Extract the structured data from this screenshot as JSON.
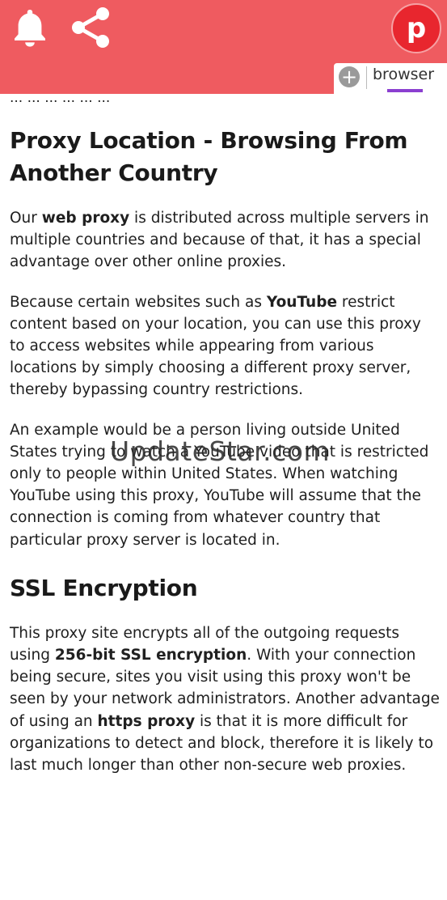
{
  "header": {
    "avatar_letter": "p",
    "tab_label": "browser",
    "add_tab_symbol": "+",
    "bg_color": "#ef5b60",
    "avatar_color": "#e8262e",
    "indicator_color": "#8b3fd0",
    "icons": [
      "bell-icon",
      "share-icon",
      "plus-icon"
    ]
  },
  "article": {
    "cut_off_text": "... ... ... ... ... ...",
    "h1": "Proxy Location - Browsing From Another Country",
    "p1": {
      "pre": "Our ",
      "bold": "web proxy",
      "post": " is distributed across multiple servers in multiple countries and because of that, it has a special advantage over other online proxies."
    },
    "p2": {
      "pre": "Because certain websites such as ",
      "bold": "YouTube",
      "post": " restrict content based on your location, you can use this proxy to access websites while appearing from various locations by simply choosing a different proxy server, thereby bypassing country restrictions."
    },
    "p3": "An example would be a person living outside United States trying to watch a YouTube video that is restricted only to people within United States. When watching YouTube using this proxy, YouTube will assume that the connection is coming from whatever country that particular proxy server is located in.",
    "h2": "SSL Encryption",
    "p4": {
      "pre": "This proxy site encrypts all of the outgoing requests using ",
      "bold1": "256-bit SSL encryption",
      "mid": ". With your connection being secure, sites you visit using this proxy won't be seen by your network administrators. Another advantage of using an ",
      "bold2": "https proxy",
      "post": " is that it is more difficult for organizations to detect and block, therefore it is likely to last much longer than other non-secure web proxies."
    }
  },
  "watermark": "UpdateStar.com"
}
